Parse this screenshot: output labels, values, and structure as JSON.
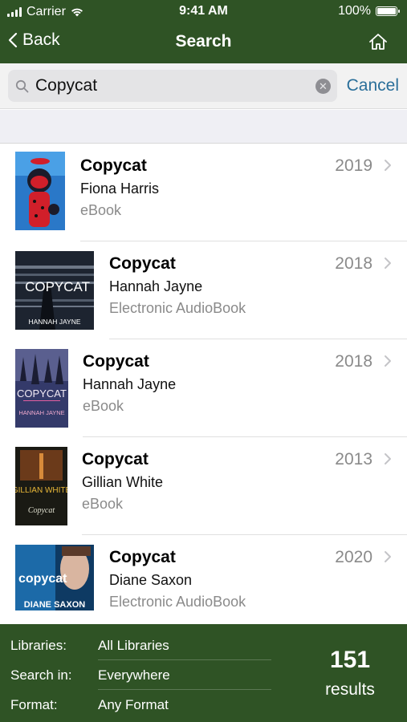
{
  "status_bar": {
    "carrier": "Carrier",
    "time": "9:41 AM",
    "battery": "100%"
  },
  "nav": {
    "back_label": "Back",
    "title": "Search",
    "home_icon": "home-icon"
  },
  "search": {
    "value": "Copycat",
    "cancel_label": "Cancel"
  },
  "results": [
    {
      "title": "Copycat",
      "author": "Fiona Harris",
      "format": "eBook",
      "year": "2019",
      "cover_text": ""
    },
    {
      "title": "Copycat",
      "author": "Hannah Jayne",
      "format": "Electronic AudioBook",
      "year": "2018",
      "cover_text": "COPYCAT",
      "cover_author": "HANNAH JAYNE"
    },
    {
      "title": "Copycat",
      "author": "Hannah Jayne",
      "format": "eBook",
      "year": "2018",
      "cover_text": "COPYCAT",
      "cover_author": "HANNAH JAYNE"
    },
    {
      "title": "Copycat",
      "author": "Gillian White",
      "format": "eBook",
      "year": "2013",
      "cover_text": "GILLIAN WHITE",
      "cover_author": "Copycat"
    },
    {
      "title": "Copycat",
      "author": "Diane Saxon",
      "format": "Electronic AudioBook",
      "year": "2020",
      "cover_text": "copycat",
      "cover_author": "DIANE SAXON"
    }
  ],
  "footer": {
    "libraries_label": "Libraries:",
    "libraries_value": "All Libraries",
    "search_in_label": "Search in:",
    "search_in_value": "Everywhere",
    "format_label": "Format:",
    "format_value": "Any Format",
    "count": "151",
    "count_label": "results"
  },
  "colors": {
    "brand_green": "#2f5325",
    "link_blue": "#2a6f9a",
    "secondary_gray": "#8a8a8a"
  }
}
